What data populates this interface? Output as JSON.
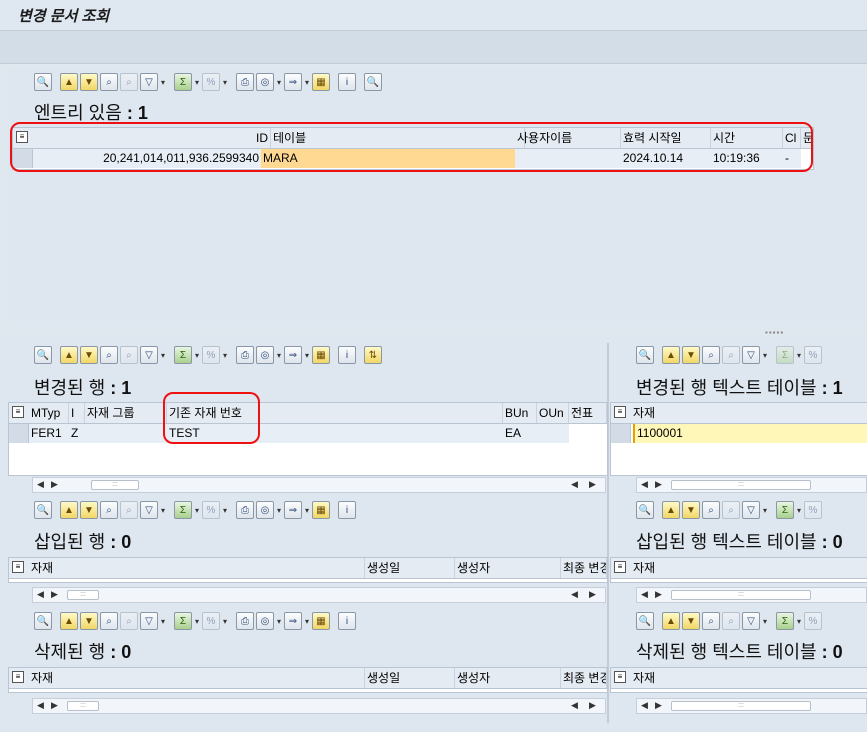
{
  "window": {
    "title": "변경 문서 조회"
  },
  "top_section": {
    "heading_label": "엔트리 있음",
    "heading_count": "1",
    "columns": [
      "ID",
      "테이블",
      "사용자이름",
      "효력 시작일",
      "시간",
      "Cl",
      "문"
    ],
    "row": {
      "id": "20,241,014,011,936.2599340",
      "table": "MARA",
      "user": "",
      "valid_from": "2024.10.14",
      "time": "10:19:36",
      "cl": "-"
    }
  },
  "changed": {
    "heading_label": "변경된 행",
    "heading_count": "1",
    "columns": [
      "MTyp",
      "I",
      "자재 그룹",
      "기존 자재 번호",
      "BUn",
      "OUn",
      "전표"
    ],
    "row": {
      "mtyp": "FER1",
      "i": "Z",
      "matgroup": "",
      "old_mat_no": "TEST",
      "bun": "EA",
      "oun": ""
    }
  },
  "changed_text": {
    "heading_label": "변경된 행 텍스트 테이블",
    "heading_count": "1",
    "columns": [
      "자재"
    ],
    "row": {
      "material": "1100001"
    }
  },
  "inserted": {
    "heading_label": "삽입된 행",
    "heading_count": "0",
    "columns": [
      "자재",
      "생성일",
      "생성자",
      "최종 변경"
    ]
  },
  "inserted_text": {
    "heading_label": "삽입된 행 텍스트 테이블",
    "heading_count": "0",
    "columns": [
      "자재"
    ]
  },
  "deleted": {
    "heading_label": "삭제된 행",
    "heading_count": "0",
    "columns": [
      "자재",
      "생성일",
      "생성자",
      "최종 변경"
    ]
  },
  "deleted_text": {
    "heading_label": "삭제된 행 텍스트 테이블",
    "heading_count": "0",
    "columns": [
      "자재"
    ]
  },
  "scroll_thumb_glyph": ":::",
  "colors": {
    "highlight": "#ffd992",
    "yellow_cell": "#fff7b8",
    "red_annotation": "#e11111"
  }
}
